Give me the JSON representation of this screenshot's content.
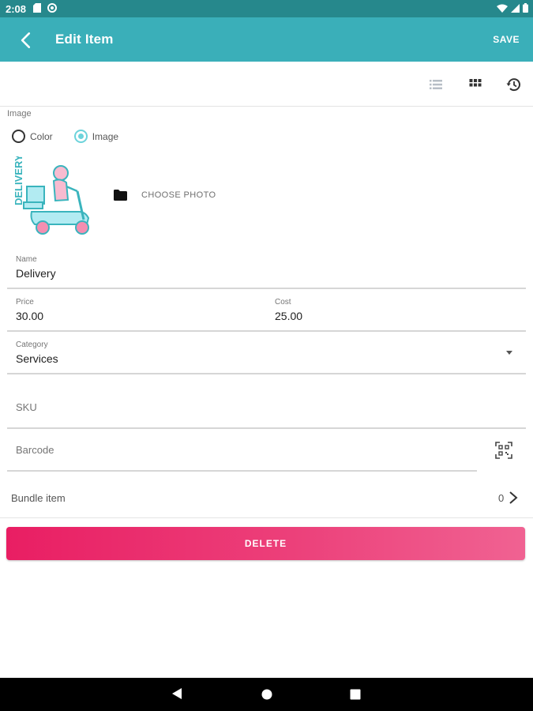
{
  "status_bar": {
    "time": "2:08"
  },
  "app_bar": {
    "title": "Edit Item",
    "save_label": "SAVE"
  },
  "form": {
    "section_label": "Image",
    "radio_options": [
      {
        "label": "Color",
        "checked": false
      },
      {
        "label": "Image",
        "checked": true
      }
    ],
    "image_text": "DELIVERY",
    "choose_photo_label": "CHOOSE PHOTO",
    "name": {
      "label": "Name",
      "value": "Delivery"
    },
    "price": {
      "label": "Price",
      "value": "30.00"
    },
    "cost": {
      "label": "Cost",
      "value": "25.00"
    },
    "category": {
      "label": "Category",
      "value": "Services"
    },
    "sku": {
      "placeholder": "SKU"
    },
    "barcode": {
      "placeholder": "Barcode"
    },
    "bundle": {
      "label": "Bundle item",
      "count": "0"
    },
    "delete_label": "DELETE"
  },
  "colors": {
    "app_bar": "#3aafb9",
    "status_bar": "#26888c",
    "accent": "#6cd3db",
    "delete": "#e91e63",
    "illustration_teal": "#3ab4bd",
    "illustration_pink": "#f48fb1"
  }
}
